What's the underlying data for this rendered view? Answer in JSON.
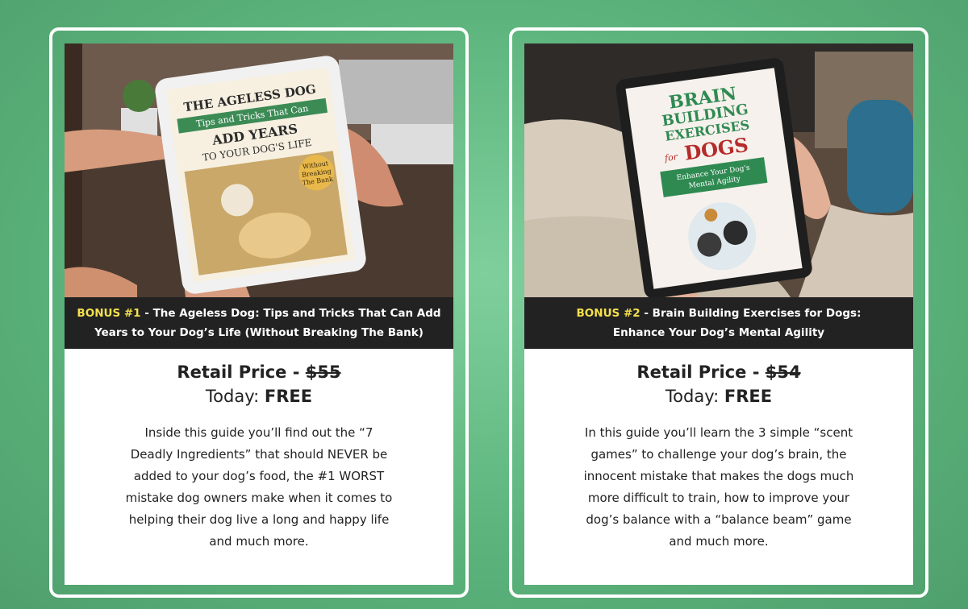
{
  "cards": [
    {
      "cover": {
        "title": "THE AGELESS DOG",
        "banner": "Tips and Tricks That Can",
        "headline1": "ADD YEARS",
        "headline2": "TO YOUR DOG'S LIFE",
        "badge1": "Without",
        "badge2": "Breaking",
        "badge3": "The Bank"
      },
      "caption_prefix": "BONUS #1",
      "caption_line1": " - The Ageless Dog: Tips and Tricks That Can Add",
      "caption_line2": "Years to Your Dog’s Life (Without Breaking The Bank)",
      "price_label": "Retail Price - ",
      "price_value": "$55",
      "today_label": "Today: ",
      "today_value": "FREE",
      "desc_lines": [
        "Inside this guide you’ll find out the “7",
        "Deadly Ingredients” that should NEVER be",
        "added to your dog’s food, the #1 WORST",
        "mistake dog owners make when it comes to",
        "helping their dog live a long and happy life",
        "and much more."
      ]
    },
    {
      "cover": {
        "line1": "BRAIN",
        "line2": "BUILDING",
        "line3": "EXERCISES",
        "for": "for",
        "dogs": "DOGS",
        "banner1": "Enhance Your Dog's",
        "banner2": "Mental Agility"
      },
      "caption_prefix": "BONUS #2",
      "caption_line1": " - Brain Building Exercises for Dogs:",
      "caption_line2": "Enhance Your Dog’s Mental Agility",
      "price_label": "Retail Price - ",
      "price_value": "$54",
      "today_label": "Today: ",
      "today_value": "FREE",
      "desc_lines": [
        "In this guide you’ll learn the 3 simple “scent",
        "games” to challenge your dog’s brain, the",
        "innocent mistake that makes the dogs much",
        "more difficult to train, how to improve your",
        "dog’s balance with a “balance beam” game",
        "and much more."
      ]
    }
  ],
  "colors": {
    "background": "#5cb47c",
    "caption_bg": "#222222",
    "bonus_highlight": "#f4e04d",
    "cover_green": "#2e8b57"
  }
}
